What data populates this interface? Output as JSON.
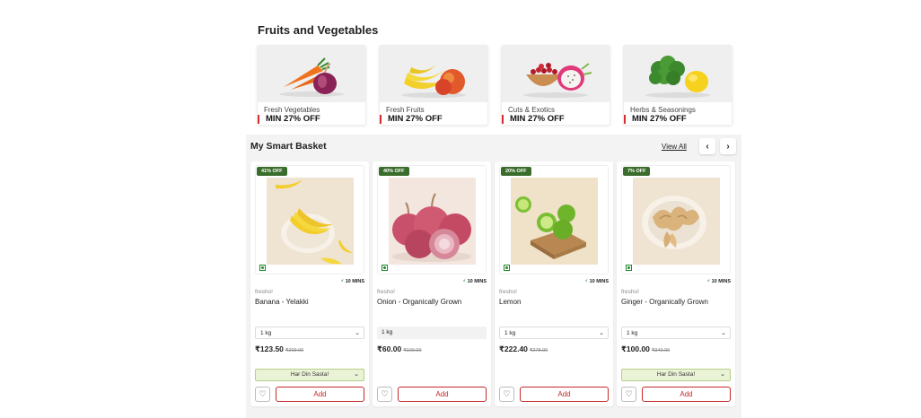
{
  "fruits_section": {
    "title": "Fruits and Vegetables",
    "categories": [
      {
        "name": "Fresh Vegetables",
        "offer": "MIN 27% OFF",
        "icon": "vegetables-icon"
      },
      {
        "name": "Fresh Fruits",
        "offer": "MIN 27% OFF",
        "icon": "fruits-icon"
      },
      {
        "name": "Cuts & Exotics",
        "offer": "MIN 27% OFF",
        "icon": "exotics-icon"
      },
      {
        "name": "Herbs & Seasonings",
        "offer": "MIN 27% OFF",
        "icon": "herbs-icon"
      }
    ]
  },
  "basket": {
    "title": "My Smart Basket",
    "view_all": "View All",
    "prev_icon": "‹",
    "next_icon": "›",
    "products": [
      {
        "discount": "41% OFF",
        "delivery": "10 MINS",
        "brand": "fresho!",
        "name": "Banana - Yelakki",
        "size": "1 kg",
        "price": "₹123.50",
        "mrp": "₹209.00",
        "promo": "Har Din Sasta!",
        "add_label": "Add"
      },
      {
        "discount": "40% OFF",
        "delivery": "10 MINS",
        "brand": "fresho!",
        "name": "Onion - Organically Grown",
        "size": "1 kg",
        "price": "₹60.00",
        "mrp": "₹100.00",
        "promo": "",
        "add_label": "Add"
      },
      {
        "discount": "20% OFF",
        "delivery": "10 MINS",
        "brand": "fresho!",
        "name": "Lemon",
        "size": "1 kg",
        "price": "₹222.40",
        "mrp": "₹278.00",
        "promo": "",
        "add_label": "Add"
      },
      {
        "discount": "7% OFF",
        "delivery": "10 MINS",
        "brand": "fresho!",
        "name": "Ginger - Organically Grown",
        "size": "1 kg",
        "price": "₹100.00",
        "mrp": "₹340.00",
        "promo": "Har Din Sasta!",
        "add_label": "Add"
      }
    ]
  },
  "colors": {
    "accent_red": "#c62828",
    "discount_green": "#3a6c2c",
    "veg_green": "#1f8a2a"
  }
}
